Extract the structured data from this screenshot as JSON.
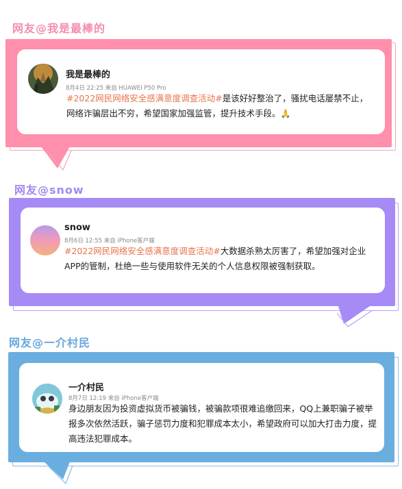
{
  "colors": {
    "pink": "#ff8fab",
    "purple": "#a68af5",
    "blue": "#6aaee0",
    "hashtag": "#e8734a"
  },
  "posts": [
    {
      "heading": "网友@我是最棒的",
      "user": "我是最棒的",
      "meta": "8月4日 22:25  来自 HUAWEI P50 Pro",
      "hashtag": "#2022网民网络安全感满意度调查活动#",
      "text": "是该好好整治了，骚扰电话屡禁不止，网络诈骗层出不穷，希望国家加强监管，提升技术手段。",
      "emoji": "🙏"
    },
    {
      "heading": "网友@snow",
      "user": "snow",
      "meta": "8月6日 12:55  来自 iPhone客户端",
      "hashtag": "#2022网民网络安全感满意度调查活动#",
      "text": "大数据杀熟太厉害了，希望加强对企业APP的管制，杜绝一些与使用软件无关的个人信息权限被强制获取。"
    },
    {
      "heading": "网友@一介村民",
      "user": "一介村民",
      "meta": "8月7日 12:19  来自 iPhone客户端",
      "text": "身边朋友因为投资虚拟货币被骗钱，被骗款项很难追缴回来，QQ上兼职骗子被举报多次依然活跃，骗子惩罚力度和犯罪成本太小，希望政府可以加大打击力度，提高违法犯罪成本。"
    }
  ]
}
